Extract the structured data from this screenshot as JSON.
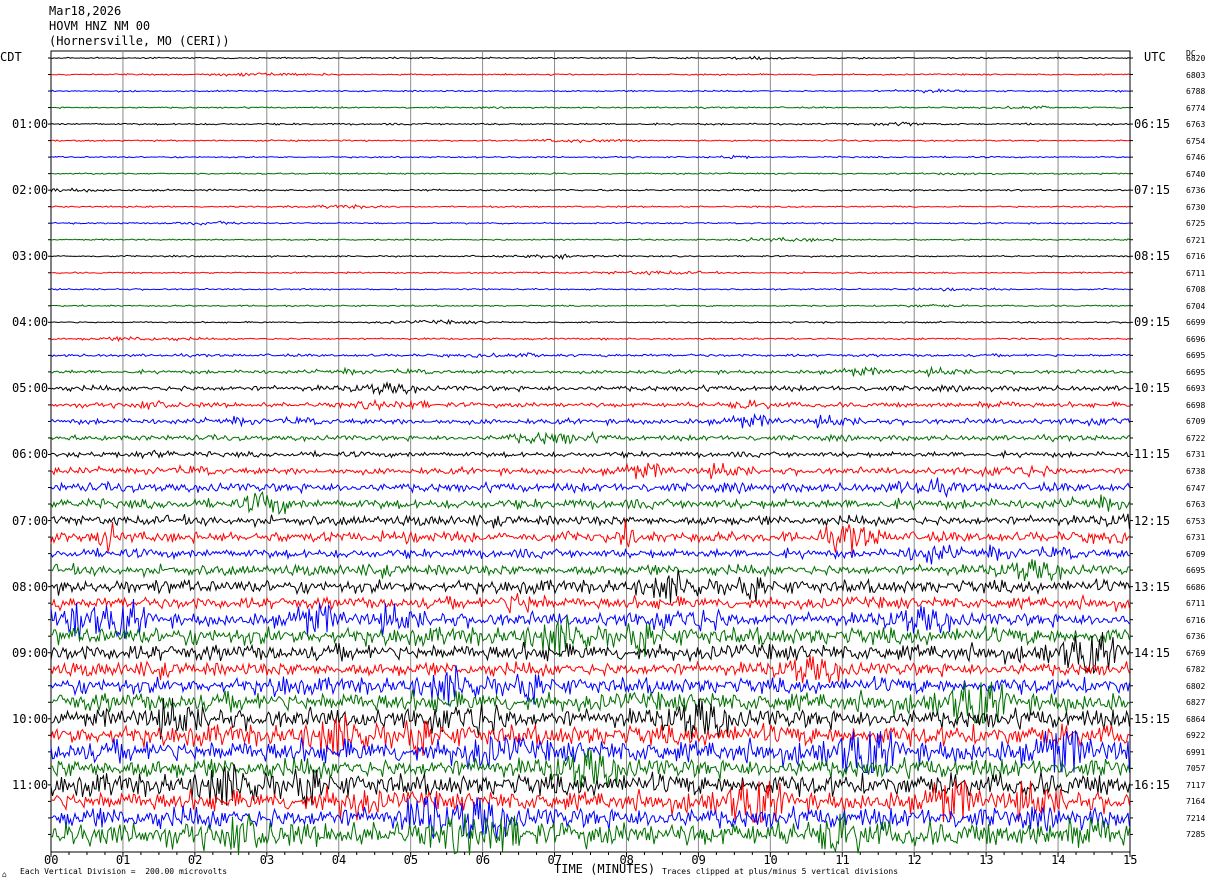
{
  "header": {
    "date": "Mar18,2026",
    "station": "HOVM HNZ NM 00",
    "location": "(Hornersville, MO (CERI))"
  },
  "left_timezone": "CDT",
  "right_timezone": "UTC",
  "dc_header": "DC",
  "footer": {
    "scale_note": "Each Vertical Division =  200.00 microvolts",
    "clip_note": "Traces clipped at plus/minus 5 vertical divisions",
    "corner_mark": "⌂"
  },
  "colors": [
    "#000000",
    "#ff0000",
    "#0000ff",
    "#007000"
  ],
  "chart_data": {
    "type": "line",
    "title": "HOVM HNZ NM 00",
    "xlabel": "TIME (MINUTES)",
    "ylabel": "",
    "x_ticks": [
      "00",
      "01",
      "02",
      "03",
      "04",
      "05",
      "06",
      "07",
      "08",
      "09",
      "10",
      "11",
      "12",
      "13",
      "14",
      "15"
    ],
    "xlim": [
      0,
      15
    ],
    "grid": true,
    "left_time_labels": [
      "01:00",
      "02:00",
      "03:00",
      "04:00",
      "05:00",
      "06:00",
      "07:00",
      "08:00",
      "09:00",
      "10:00",
      "11:00"
    ],
    "right_time_labels": [
      "06:15",
      "07:15",
      "08:15",
      "09:15",
      "10:15",
      "11:15",
      "12:15",
      "13:15",
      "14:15",
      "15:15",
      "16:15"
    ],
    "dc_offsets": [
      "6820",
      "6803",
      "6788",
      "6774",
      "6763",
      "6754",
      "6746",
      "6740",
      "6736",
      "6730",
      "6725",
      "6721",
      "6716",
      "6711",
      "6708",
      "6704",
      "6699",
      "6696",
      "6695",
      "6695",
      "6693",
      "6698",
      "6709",
      "6722",
      "6731",
      "6738",
      "6747",
      "6763",
      "6753",
      "6731",
      "6709",
      "6695",
      "6686",
      "6711",
      "6716",
      "6736",
      "6769",
      "6782",
      "6802",
      "6827",
      "6864",
      "6922",
      "6991",
      "7057",
      "7117",
      "7164",
      "7214",
      "7285"
    ],
    "trace_activity": [
      0.5,
      0.5,
      0.5,
      0.5,
      0.6,
      0.5,
      0.5,
      0.5,
      0.6,
      0.5,
      0.5,
      0.5,
      0.5,
      0.5,
      0.5,
      0.5,
      0.5,
      0.6,
      0.9,
      1.2,
      1.8,
      1.6,
      1.8,
      1.8,
      1.8,
      2.2,
      3.0,
      3.2,
      3.2,
      3.5,
      3.0,
      3.5,
      4.5,
      4.0,
      4.5,
      6.0,
      5.5,
      4.5,
      5.5,
      6.5,
      6.5,
      7.0,
      7.5,
      6.5,
      7.5,
      6.5,
      7.0,
      8.0
    ]
  }
}
